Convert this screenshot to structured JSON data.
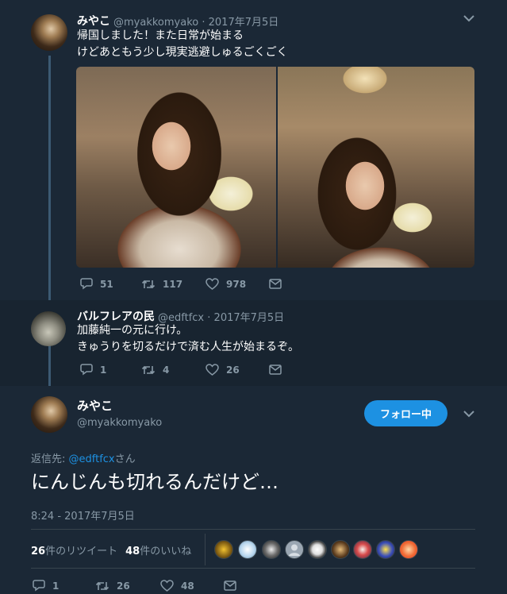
{
  "tweet1": {
    "name": "みやこ",
    "handle": "@myakkomyako",
    "separator": "·",
    "date": "2017年7月5日",
    "line1": "帰国しました！また日常が始まる",
    "line2": "けどあともう少し現実逃避しゅるごくごく",
    "replies": "51",
    "retweets": "117",
    "likes": "978"
  },
  "tweet2": {
    "name": "バルフレアの民",
    "handle": "@edftfcx",
    "separator": "·",
    "date": "2017年7月5日",
    "line1": "加藤純一の元に行け。",
    "line2": "きゅうりを切るだけで済む人生が始まるぞ。",
    "replies": "1",
    "retweets": "4",
    "likes": "26"
  },
  "tweet3": {
    "name": "みやこ",
    "handle": "@myakkomyako",
    "follow_label": "フォロー中",
    "reply_prefix": "返信先: ",
    "reply_to": "@edftfcx",
    "reply_suffix": "さん",
    "text": "にんじんも切れるんだけど…",
    "timestamp": "8:24 - 2017年7月5日",
    "retweet_count": "26",
    "retweet_label": "件のリツイート",
    "like_count": "48",
    "like_label": "件のいいね",
    "replies": "1",
    "retweets": "26",
    "likes": "48"
  },
  "icons": [
    "chevron-down-icon",
    "reply-icon",
    "retweet-icon",
    "like-icon",
    "dm-icon"
  ],
  "colors": {
    "background": "#1b2836",
    "reply_background": "#182430",
    "accent": "#1d91e2",
    "muted": "#8899a6",
    "thread_line": "#3c5a73"
  }
}
